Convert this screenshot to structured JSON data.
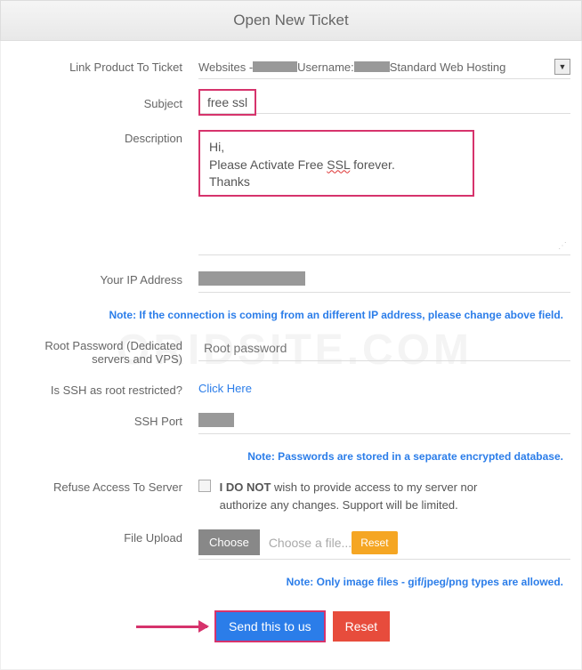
{
  "header": {
    "title": "Open New Ticket"
  },
  "watermark": "ORIDSITE.COM",
  "labels": {
    "link_product": "Link Product To Ticket",
    "subject": "Subject",
    "description": "Description",
    "ip": "Your IP Address",
    "root_pw": "Root Password (Dedicated servers and VPS)",
    "ssh_restricted": "Is SSH as root restricted?",
    "ssh_port": "SSH Port",
    "refuse": "Refuse Access To Server",
    "file_upload": "File Upload"
  },
  "product": {
    "prefix": "Websites - ",
    "mid": "Username:",
    "suffix": "Standard Web Hosting"
  },
  "subject": {
    "value": "free ssl"
  },
  "description": {
    "line1": "Hi,",
    "line2a": "Please Activate Free ",
    "line2b": "SSL",
    "line2c": " forever.",
    "line3": "Thanks"
  },
  "notes": {
    "ip": "Note: If the connection is coming from an different IP address, please change above field.",
    "pw": "Note: Passwords are stored in a separate encrypted database.",
    "file": "Note: Only image files - gif/jpeg/png types are allowed."
  },
  "root_pw": {
    "placeholder": "Root password"
  },
  "ssh_link": "Click Here",
  "refuse_text": {
    "bold": "I DO NOT",
    "rest": " wish to provide access to my server nor authorize any changes. Support will be limited."
  },
  "file": {
    "choose": "Choose",
    "placeholder": "Choose a file...",
    "reset": "Reset"
  },
  "actions": {
    "send": "Send this to us",
    "reset": "Reset"
  }
}
